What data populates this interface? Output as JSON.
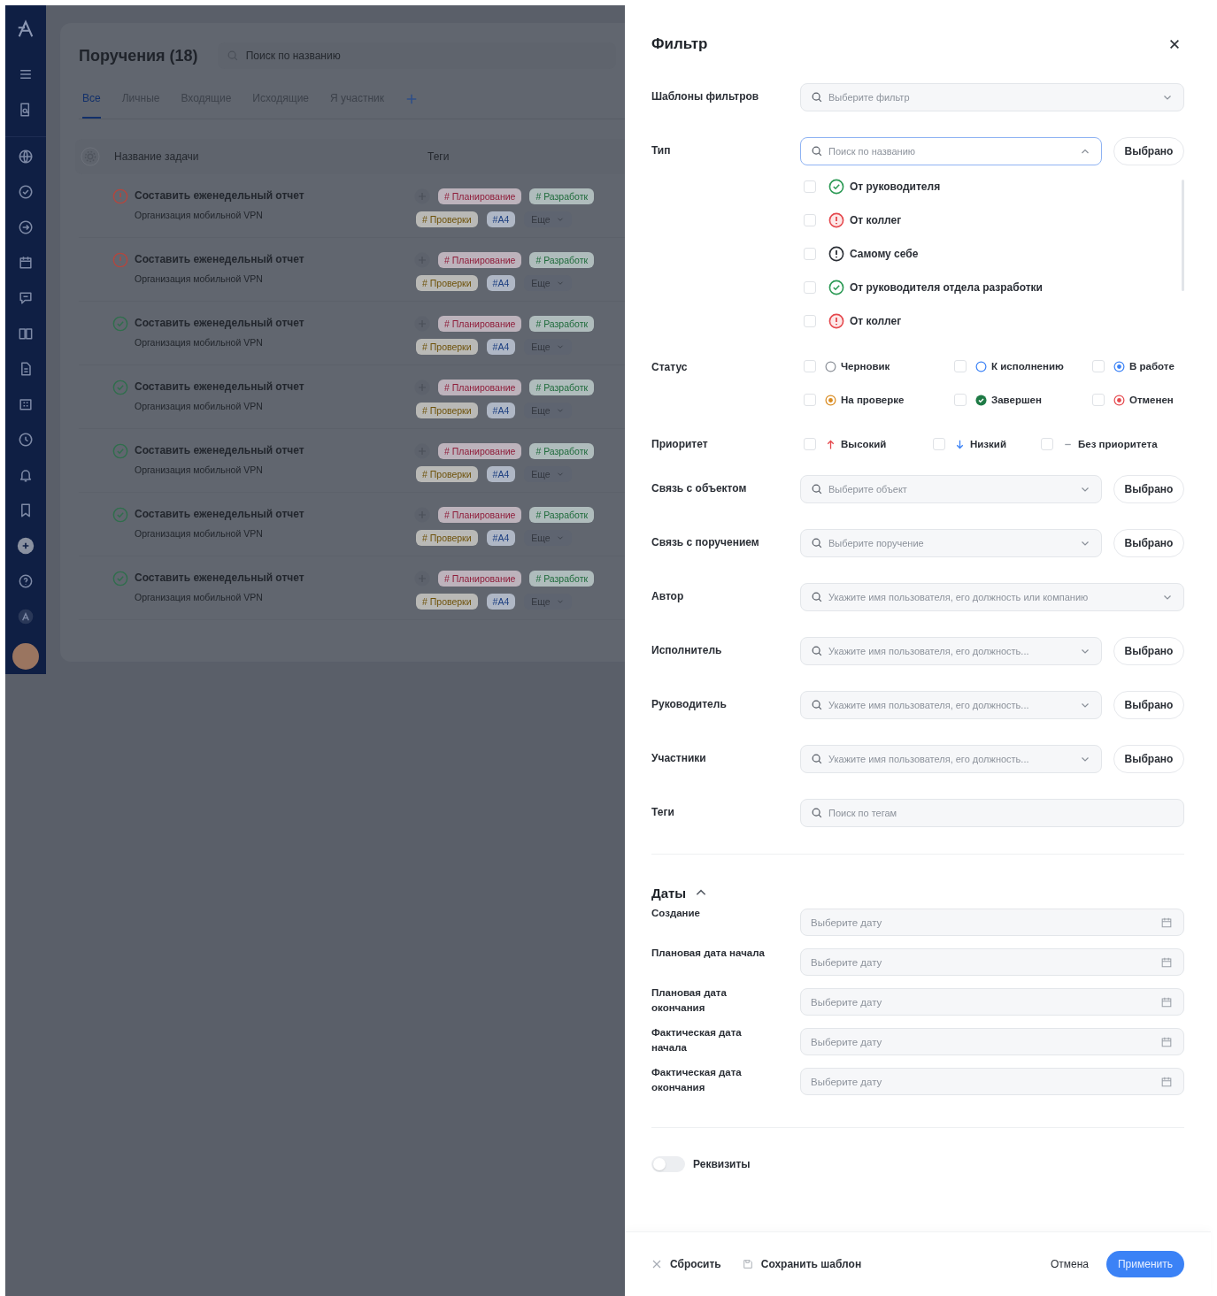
{
  "app": {
    "title": "Поручения (18)",
    "search": {
      "placeholder": "Поиск по названию"
    },
    "tabs": [
      {
        "label": "Все",
        "selected": true
      },
      {
        "label": "Личные",
        "selected": false
      },
      {
        "label": "Входящие",
        "selected": false
      },
      {
        "label": "Исходящие",
        "selected": false
      },
      {
        "label": "Я участник",
        "selected": false
      }
    ],
    "table": {
      "columns": [
        "Название задачи",
        "Теги"
      ],
      "rows": [
        {
          "kind": "alert",
          "title": "Составить еженедельный отчет",
          "subtitle": "Организация мобильной VPN",
          "tags": [
            {
              "label": "# Планирование",
              "color": "#8f1d3a"
            },
            {
              "label": "# Разработк",
              "color": "#1d6a3a"
            }
          ],
          "tags2": [
            {
              "label": "# Проверки",
              "color": "#6e520a"
            },
            {
              "label": "#A4",
              "color": "#1d3f80"
            }
          ],
          "more": "Еще"
        },
        {
          "kind": "alert",
          "title": "Составить еженедельный отчет",
          "subtitle": "Организация мобильной VPN",
          "tags": [
            {
              "label": "# Планирование",
              "color": "#8f1d3a"
            },
            {
              "label": "# Разработк",
              "color": "#1d6a3a"
            }
          ],
          "tags2": [
            {
              "label": "# Проверки",
              "color": "#6e520a"
            },
            {
              "label": "#A4",
              "color": "#1d3f80"
            }
          ],
          "more": "Еще"
        },
        {
          "kind": "done",
          "title": "Составить еженедельный отчет",
          "subtitle": "Организация мобильной VPN",
          "tags": [
            {
              "label": "# Планирование",
              "color": "#8f1d3a"
            },
            {
              "label": "# Разработк",
              "color": "#1d6a3a"
            }
          ],
          "tags2": [
            {
              "label": "# Проверки",
              "color": "#6e520a"
            },
            {
              "label": "#A4",
              "color": "#1d3f80"
            }
          ],
          "more": "Еще"
        },
        {
          "kind": "done",
          "title": "Составить еженедельный отчет",
          "subtitle": "Организация мобильной VPN",
          "tags": [
            {
              "label": "# Планирование",
              "color": "#8f1d3a"
            },
            {
              "label": "# Разработк",
              "color": "#1d6a3a"
            }
          ],
          "tags2": [
            {
              "label": "# Проверки",
              "color": "#6e520a"
            },
            {
              "label": "#A4",
              "color": "#1d3f80"
            }
          ],
          "more": "Еще"
        },
        {
          "kind": "done",
          "title": "Составить еженедельный отчет",
          "subtitle": "Организация мобильной VPN",
          "tags": [
            {
              "label": "# Планирование",
              "color": "#8f1d3a"
            },
            {
              "label": "# Разработк",
              "color": "#1d6a3a"
            }
          ],
          "tags2": [
            {
              "label": "# Проверки",
              "color": "#6e520a"
            },
            {
              "label": "#A4",
              "color": "#1d3f80"
            }
          ],
          "more": "Еще"
        },
        {
          "kind": "done",
          "title": "Составить еженедельный отчет",
          "subtitle": "Организация мобильной VPN",
          "tags": [
            {
              "label": "# Планирование",
              "color": "#8f1d3a"
            },
            {
              "label": "# Разработк",
              "color": "#1d6a3a"
            }
          ],
          "tags2": [
            {
              "label": "# Проверки",
              "color": "#6e520a"
            },
            {
              "label": "#A4",
              "color": "#1d3f80"
            }
          ],
          "more": "Еще"
        },
        {
          "kind": "done",
          "title": "Составить еженедельный отчет",
          "subtitle": "Организация мобильной VPN",
          "tags": [
            {
              "label": "# Планирование",
              "color": "#8f1d3a"
            },
            {
              "label": "# Разработк",
              "color": "#1d6a3a"
            }
          ],
          "tags2": [
            {
              "label": "# Проверки",
              "color": "#6e520a"
            },
            {
              "label": "#A4",
              "color": "#1d3f80"
            }
          ],
          "more": "Еще"
        }
      ]
    }
  },
  "filter": {
    "title": "Фильтр",
    "rows": [
      {
        "kind": "select",
        "label": "Шаблоны фильтров",
        "placeholder": "Выберите фильтр",
        "open": false
      },
      {
        "kind": "select",
        "label": "Тип",
        "placeholder": "Поиск по названию",
        "open": true,
        "button": "Выбрано",
        "options": [
          {
            "label": "От руководителя",
            "kind": "check",
            "checked": false
          },
          {
            "label": "От коллег",
            "kind": "alert",
            "checked": false
          },
          {
            "label": "Самому себе",
            "kind": "alert-dark",
            "checked": false
          },
          {
            "label": "От руководителя отдела разработки",
            "kind": "check",
            "checked": false
          },
          {
            "label": "От коллег",
            "kind": "alert",
            "checked": false
          }
        ]
      },
      {
        "kind": "status",
        "label": "Статус",
        "items": [
          {
            "label": "Черновик",
            "kind": "draft",
            "checked": false
          },
          {
            "label": "К исполнению",
            "kind": "todo",
            "checked": false
          },
          {
            "label": "В работе",
            "kind": "progress",
            "checked": false
          },
          {
            "label": "На проверке",
            "kind": "review",
            "checked": false
          },
          {
            "label": "Завершен",
            "kind": "done",
            "checked": false
          },
          {
            "label": "Отменен",
            "kind": "cancelled",
            "checked": false
          }
        ]
      },
      {
        "kind": "priority",
        "label": "Приоритет",
        "items": [
          {
            "label": "Высокий",
            "kind": "up",
            "checked": false
          },
          {
            "label": "Низкий",
            "kind": "down",
            "checked": false
          },
          {
            "label": "Без приоритета",
            "kind": "none",
            "checked": false
          }
        ]
      },
      {
        "kind": "select",
        "label": "Связь с объектом",
        "placeholder": "Выберите объект",
        "open": false,
        "button": "Выбрано"
      },
      {
        "kind": "select",
        "label": "Связь с поручением",
        "placeholder": "Выберите поручение",
        "open": false,
        "button": "Выбрано"
      },
      {
        "kind": "select",
        "label": "Автор",
        "placeholder": "Укажите имя пользователя, его должность или компанию",
        "open": false
      },
      {
        "kind": "select",
        "label": "Исполнитель",
        "placeholder": "Укажите имя пользователя, его должность...",
        "open": false,
        "button": "Выбрано"
      },
      {
        "kind": "select",
        "label": "Руководитель",
        "placeholder": "Укажите имя пользователя, его должность...",
        "open": false,
        "button": "Выбрано"
      },
      {
        "kind": "select",
        "label": "Участники",
        "placeholder": "Укажите имя пользователя, его должность...",
        "open": false,
        "button": "Выбрано"
      },
      {
        "kind": "search",
        "label": "Теги",
        "placeholder": "Поиск по тегам"
      }
    ],
    "dates": {
      "title": "Даты",
      "expanded": true,
      "rows": [
        {
          "label": "Создание",
          "placeholder": "Выберите дату"
        },
        {
          "label": "Плановая дата начала",
          "placeholder": "Выберите дату"
        },
        {
          "label": "Плановая дата окончания",
          "placeholder": "Выберите дату"
        },
        {
          "label": "Фактическая дата начала",
          "placeholder": "Выберите дату"
        },
        {
          "label": "Фактическая дата окончания",
          "placeholder": "Выберите дату"
        }
      ]
    },
    "requisites": {
      "label": "Реквизиты",
      "on": false
    },
    "footer": {
      "reset": "Сбросить",
      "save": "Сохранить шаблон",
      "cancel": "Отмена",
      "apply": "Применить"
    }
  }
}
